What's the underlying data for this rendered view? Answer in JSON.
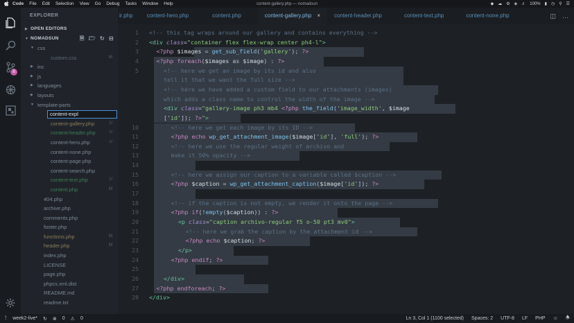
{
  "menubar": {
    "apple": "",
    "items": [
      "Code",
      "File",
      "Edit",
      "Selection",
      "View",
      "Go",
      "Debug",
      "Tasks",
      "Window",
      "Help"
    ],
    "window_title": "content-gallery.php — nomadsun",
    "battery": "100%",
    "clock_icon": "clock-icon"
  },
  "sidebar": {
    "header": "EXPLORER",
    "open_editors": "OPEN EDITORS",
    "project": "NOMADSUN",
    "rename_value": "content-expl",
    "tree": [
      {
        "label": "css",
        "depth": 1,
        "type": "folder",
        "style": "dim",
        "open": true,
        "mark": ""
      },
      {
        "label": "custom.css",
        "depth": 2,
        "type": "file",
        "style": "dim",
        "mark": "M"
      },
      {
        "label": "inc",
        "depth": 1,
        "type": "folder",
        "style": "dim",
        "open": false,
        "mark": ""
      },
      {
        "label": "js",
        "depth": 1,
        "type": "folder",
        "style": "dim",
        "open": false,
        "mark": ""
      },
      {
        "label": "languages",
        "depth": 1,
        "type": "folder",
        "style": "folder",
        "open": false,
        "mark": ""
      },
      {
        "label": "layouts",
        "depth": 1,
        "type": "folder",
        "style": "folder",
        "open": false,
        "mark": ""
      },
      {
        "label": "template-parts",
        "depth": 1,
        "type": "folder",
        "style": "dim",
        "open": true,
        "mark": ""
      },
      {
        "label": "",
        "depth": 2,
        "type": "rename",
        "style": "",
        "mark": ""
      },
      {
        "label": "content-gallery.php",
        "depth": 2,
        "type": "file",
        "style": "gitmod",
        "mark": "U"
      },
      {
        "label": "content-header.php",
        "depth": 2,
        "type": "file",
        "style": "green",
        "mark": "U"
      },
      {
        "label": "content-hero.php",
        "depth": 2,
        "type": "file",
        "style": "norm",
        "mark": "U"
      },
      {
        "label": "content-none.php",
        "depth": 2,
        "type": "file",
        "style": "norm",
        "mark": ""
      },
      {
        "label": "content-page.php",
        "depth": 2,
        "type": "file",
        "style": "norm",
        "mark": ""
      },
      {
        "label": "content-search.php",
        "depth": 2,
        "type": "file",
        "style": "norm",
        "mark": ""
      },
      {
        "label": "content-text.php",
        "depth": 2,
        "type": "file",
        "style": "green",
        "mark": "U"
      },
      {
        "label": "content.php",
        "depth": 2,
        "type": "file",
        "style": "green",
        "mark": "M"
      },
      {
        "label": "404.php",
        "depth": 1,
        "type": "file",
        "style": "norm",
        "mark": ""
      },
      {
        "label": "archive.php",
        "depth": 1,
        "type": "file",
        "style": "norm",
        "mark": ""
      },
      {
        "label": "comments.php",
        "depth": 1,
        "type": "file",
        "style": "norm",
        "mark": ""
      },
      {
        "label": "footer.php",
        "depth": 1,
        "type": "file",
        "style": "norm",
        "mark": ""
      },
      {
        "label": "functions.php",
        "depth": 1,
        "type": "file",
        "style": "gitmod",
        "mark": "M"
      },
      {
        "label": "header.php",
        "depth": 1,
        "type": "file",
        "style": "gitmod",
        "mark": "M"
      },
      {
        "label": "index.php",
        "depth": 1,
        "type": "file",
        "style": "norm",
        "mark": ""
      },
      {
        "label": "LICENSE",
        "depth": 1,
        "type": "file",
        "style": "norm",
        "mark": ""
      },
      {
        "label": "page.php",
        "depth": 1,
        "type": "file",
        "style": "norm",
        "mark": ""
      },
      {
        "label": "phpcs.xml.dist",
        "depth": 1,
        "type": "file",
        "style": "norm",
        "mark": ""
      },
      {
        "label": "README.md",
        "depth": 1,
        "type": "file",
        "style": "norm",
        "mark": ""
      },
      {
        "label": "readme.txt",
        "depth": 1,
        "type": "file",
        "style": "norm",
        "mark": ""
      }
    ]
  },
  "tabs": [
    {
      "label": "ir.php",
      "active": false
    },
    {
      "label": "content-hero.php",
      "active": false
    },
    {
      "label": "content.php",
      "active": false
    },
    {
      "label": "content-gallery.php",
      "active": true
    },
    {
      "label": "content-header.php",
      "active": false
    },
    {
      "label": "content-text.php",
      "active": false
    },
    {
      "label": "content-none.php",
      "active": false
    }
  ],
  "editor": {
    "lines": [
      {
        "n": "1",
        "indent": 0,
        "tokens": [
          [
            "com",
            "<!-- this tag wraps around our gallery and contains everything -->"
          ]
        ]
      },
      {
        "n": "2",
        "indent": 0,
        "tokens": [
          [
            "tag",
            "<div "
          ],
          [
            "attr",
            "class"
          ],
          [
            "plain",
            "="
          ],
          [
            "str",
            "\"container flex flex-wrap center ph4-l\""
          ],
          [
            "tag",
            ">"
          ]
        ]
      },
      {
        "n": "3",
        "indent": 1,
        "tokens": [
          [
            "php",
            "<?php "
          ],
          [
            "var",
            "$images"
          ],
          [
            "plain",
            " = "
          ],
          [
            "fn",
            "get_sub_field"
          ],
          [
            "plain",
            "("
          ],
          [
            "str",
            "'gallery'"
          ],
          [
            "plain",
            "); "
          ],
          [
            "php",
            "?>"
          ]
        ]
      },
      {
        "n": "4",
        "indent": 1,
        "tokens": [
          [
            "php",
            "<?php "
          ],
          [
            "key",
            "foreach"
          ],
          [
            "plain",
            "("
          ],
          [
            "var",
            "$images"
          ],
          [
            "plain",
            " as "
          ],
          [
            "var",
            "$image"
          ],
          [
            "plain",
            ") : "
          ],
          [
            "php",
            "?>"
          ]
        ]
      },
      {
        "n": "5",
        "indent": 2,
        "tokens": [
          [
            "com",
            "<!-- here we get an image by its id and also"
          ]
        ]
      },
      {
        "n": "",
        "indent": 2,
        "tokens": [
          [
            "com",
            "tell it that we want the full size -->"
          ]
        ]
      },
      {
        "n": "",
        "indent": 2,
        "tokens": [
          [
            "com",
            "<!-- here we have added a custom field to our attachments (images)"
          ]
        ]
      },
      {
        "n": "",
        "indent": 2,
        "tokens": [
          [
            "com",
            "which adds a class name to control the width of the image -->"
          ]
        ]
      },
      {
        "n": "",
        "indent": 2,
        "tokens": [
          [
            "tag",
            "<div "
          ],
          [
            "attr",
            "class"
          ],
          [
            "plain",
            "="
          ],
          [
            "str",
            "\"gallery-image ph3 mb4 "
          ],
          [
            "php",
            "<?php "
          ],
          [
            "fn",
            "the_field"
          ],
          [
            "plain",
            "("
          ],
          [
            "str",
            "'image_width'"
          ],
          [
            "plain",
            ", "
          ],
          [
            "var",
            "$image"
          ]
        ]
      },
      {
        "n": "",
        "indent": 2,
        "tokens": [
          [
            "plain",
            "['"
          ],
          [
            "str",
            "id"
          ],
          [
            "plain",
            "']); "
          ],
          [
            "php",
            "?>"
          ],
          [
            "str",
            "\""
          ],
          [
            "tag",
            ">"
          ]
        ]
      },
      {
        "n": "10",
        "indent": 3,
        "tokens": [
          [
            "com",
            "<!-- here we get each image by its ID -->"
          ]
        ]
      },
      {
        "n": "11",
        "indent": 3,
        "tokens": [
          [
            "php",
            "<?php "
          ],
          [
            "key",
            "echo "
          ],
          [
            "fn",
            "wp_get_attachment_image"
          ],
          [
            "plain",
            "("
          ],
          [
            "var",
            "$image"
          ],
          [
            "plain",
            "['"
          ],
          [
            "str",
            "id"
          ],
          [
            "plain",
            "'], "
          ],
          [
            "str",
            "'full'"
          ],
          [
            "plain",
            "); "
          ],
          [
            "php",
            "?>"
          ]
        ]
      },
      {
        "n": "12",
        "indent": 3,
        "tokens": [
          [
            "com",
            "<!-- here we use the regular weight of archivo and"
          ]
        ]
      },
      {
        "n": "13",
        "indent": 3,
        "tokens": [
          [
            "com",
            "make it 50% opacity -->"
          ]
        ]
      },
      {
        "n": "14",
        "indent": 0,
        "tokens": []
      },
      {
        "n": "15",
        "indent": 3,
        "tokens": [
          [
            "com",
            "<!-- here we assign our caption to a variable called $caption -->"
          ]
        ]
      },
      {
        "n": "16",
        "indent": 3,
        "tokens": [
          [
            "php",
            "<?php "
          ],
          [
            "var",
            "$caption"
          ],
          [
            "plain",
            " = "
          ],
          [
            "fn",
            "wp_get_attachment_caption"
          ],
          [
            "plain",
            "("
          ],
          [
            "var",
            "$image"
          ],
          [
            "plain",
            "['"
          ],
          [
            "str",
            "id"
          ],
          [
            "plain",
            "']); "
          ],
          [
            "php",
            "?>"
          ]
        ]
      },
      {
        "n": "17",
        "indent": 0,
        "tokens": []
      },
      {
        "n": "18",
        "indent": 3,
        "tokens": [
          [
            "com",
            "<!-- if the caption is not empty, we render it onto the page -->"
          ]
        ]
      },
      {
        "n": "19",
        "indent": 3,
        "tokens": [
          [
            "php",
            "<?php "
          ],
          [
            "key",
            "if"
          ],
          [
            "plain",
            "(!"
          ],
          [
            "fn",
            "empty"
          ],
          [
            "plain",
            "("
          ],
          [
            "var",
            "$caption"
          ],
          [
            "plain",
            ")) : "
          ],
          [
            "php",
            "?>"
          ]
        ]
      },
      {
        "n": "20",
        "indent": 4,
        "tokens": [
          [
            "tag",
            "<p "
          ],
          [
            "attr",
            "class"
          ],
          [
            "plain",
            "="
          ],
          [
            "str",
            "\"caption archivo-regular f5 o-50 pt3 mv0\""
          ],
          [
            "tag",
            ">"
          ]
        ]
      },
      {
        "n": "21",
        "indent": 5,
        "tokens": [
          [
            "com",
            "<!-- here we grab the caption by the attachment id -->"
          ]
        ]
      },
      {
        "n": "22",
        "indent": 5,
        "tokens": [
          [
            "php",
            "<?php "
          ],
          [
            "key",
            "echo "
          ],
          [
            "var",
            "$caption"
          ],
          [
            "plain",
            "; "
          ],
          [
            "php",
            "?>"
          ]
        ]
      },
      {
        "n": "23",
        "indent": 4,
        "tokens": [
          [
            "tag",
            "</p>"
          ]
        ]
      },
      {
        "n": "24",
        "indent": 3,
        "tokens": [
          [
            "php",
            "<?php "
          ],
          [
            "key",
            "endif"
          ],
          [
            "plain",
            "; "
          ],
          [
            "php",
            "?>"
          ]
        ]
      },
      {
        "n": "25",
        "indent": 0,
        "tokens": []
      },
      {
        "n": "26",
        "indent": 2,
        "tokens": [
          [
            "tag",
            "</div>"
          ]
        ]
      },
      {
        "n": "27",
        "indent": 1,
        "tokens": [
          [
            "php",
            "<?php "
          ],
          [
            "key",
            "endforeach"
          ],
          [
            "plain",
            "; "
          ],
          [
            "php",
            "?>"
          ]
        ]
      },
      {
        "n": "28",
        "indent": 0,
        "tokens": [
          [
            "tag",
            "</div>"
          ]
        ]
      }
    ]
  },
  "statusbar": {
    "branch": "week2-live*",
    "sync_icon": "sync-icon",
    "errors": "0",
    "warnings": "0",
    "position": "Ln 3, Col 1 (1100 selected)",
    "spaces": "Spaces: 2",
    "encoding": "UTF-8",
    "eol": "LF",
    "language": "PHP"
  }
}
